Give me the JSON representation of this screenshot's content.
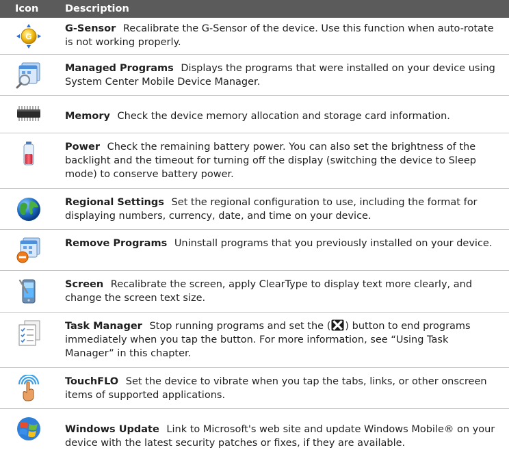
{
  "header": {
    "icon_label": "Icon",
    "description_label": "Description"
  },
  "rows": [
    {
      "icon": "g-sensor-icon",
      "title": "G-Sensor",
      "text": "Recalibrate the G-Sensor of the device. Use this function when auto-rotate is not working properly."
    },
    {
      "icon": "managed-programs-icon",
      "title": "Managed Programs",
      "text": "Displays the programs that were installed on your device using System Center Mobile Device Manager."
    },
    {
      "icon": "memory-icon",
      "title": "Memory",
      "text": "Check the device memory allocation and storage card information."
    },
    {
      "icon": "battery-icon",
      "title": "Power",
      "text": "Check the remaining battery power. You can also set the brightness of the backlight and the timeout for turning off the display (switching the device to Sleep mode) to conserve battery power."
    },
    {
      "icon": "globe-icon",
      "title": "Regional Settings",
      "text": "Set the regional configuration to use, including the format for displaying numbers, currency, date, and time on your device."
    },
    {
      "icon": "remove-programs-icon",
      "title": "Remove Programs",
      "text": "Uninstall programs that you previously installed on your device."
    },
    {
      "icon": "screen-icon",
      "title": "Screen",
      "text": "Recalibrate the screen, apply ClearType to display text more clearly, and change the screen text size."
    },
    {
      "icon": "task-manager-icon",
      "title": "Task Manager",
      "text_before": "Stop running programs and set the (",
      "text_after": ") button to end programs immediately when you tap the button. For more information, see “Using Task Manager” in this chapter."
    },
    {
      "icon": "touchflo-icon",
      "title": "TouchFLO",
      "text": "Set the device to vibrate when you tap the tabs, links, or other onscreen items of supported applications."
    },
    {
      "icon": "windows-flag-icon",
      "title": "Windows Update",
      "text": "Link to Microsoft's web site and update Windows Mobile® on your device with the latest security patches or fixes, if they are available."
    }
  ]
}
